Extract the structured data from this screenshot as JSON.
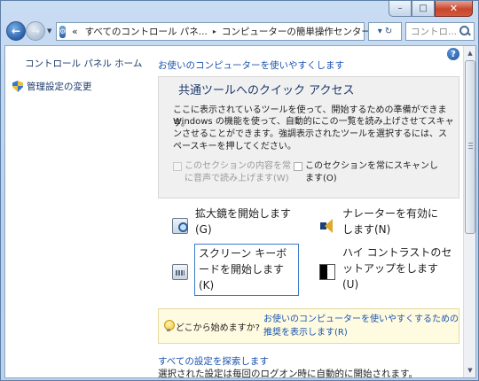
{
  "window": {
    "caption_buttons": {
      "minimize": "–",
      "maximize": "□",
      "close": "✕"
    }
  },
  "navbar": {
    "back_glyph": "←",
    "forward_glyph": "→",
    "address": {
      "overflow": "«",
      "segments": [
        "すべてのコントロール パネ...",
        "コンピューターの簡単操作センター"
      ],
      "separator": "▸"
    },
    "refresh_glyphs": "▾ ↻",
    "search_placeholder": "コントロ..."
  },
  "sidebar": {
    "home_link": "コントロール パネル ホーム",
    "admin_link": "管理設定の変更"
  },
  "main": {
    "top_link": "お使いのコンピューターを使いやすくします",
    "quick_access": {
      "title": "共通ツールへのクイック アクセス",
      "text1": "ここに表示されているツールを使って、開始するための準備ができます。",
      "text2": "Windows の機能を使って、自動的にこの一覧を読み上げさせてスキャンさせることができます。強調表示されたツールを選択するには、スペースキーを押してください。",
      "checkbox_read": "このセクションの内容を常に音声で読み上げます(W)",
      "checkbox_scan": "このセクションを常にスキャンします(O)"
    },
    "tools": {
      "magnifier": "拡大鏡を開始します(G)",
      "narrator": "ナレーターを有効にします(N)",
      "keyboard": "スクリーン キーボードを開始します(K)",
      "contrast": "ハイ コントラストのセットアップをします(U)"
    },
    "tip": {
      "question": "どこから始めますか?",
      "link": "お使いのコンピューターを使いやすくするための推奨を表示します(R)"
    },
    "explore_link": "すべての設定を探索します",
    "bottom_text": "選択された設定は毎回のログオン時に自動的に開始されます。"
  },
  "help_glyph": "?"
}
